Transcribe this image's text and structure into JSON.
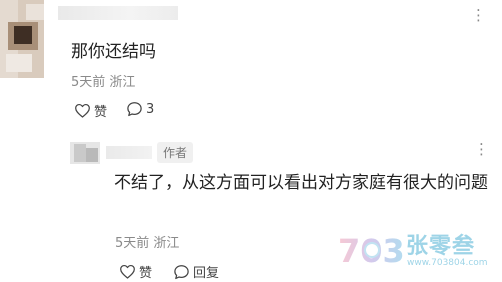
{
  "top_comment": {
    "text": "那你还结吗",
    "time": "5天前",
    "location": "浙江",
    "like_label": "赞",
    "reply_count": "3",
    "more_glyph": "⋮"
  },
  "reply": {
    "author_badge": "作者",
    "text": "不结了，从这方面可以看出对方家庭有很大的问题",
    "time": "5天前",
    "location": "浙江",
    "like_label": "赞",
    "reply_label": "回复",
    "more_glyph": "⋮"
  },
  "watermark": {
    "logo_text": "703",
    "name": "张零叁",
    "url": "www.703804.com"
  },
  "icons": {
    "like": "heart-outline-icon",
    "comment": "speech-bubble-icon",
    "more": "vertical-dots-icon"
  },
  "colors": {
    "text": "#222222",
    "meta": "#8a8a8a",
    "icon": "#444444",
    "badge_bg": "#f0f0f0",
    "watermark": "#5fb8d8"
  }
}
